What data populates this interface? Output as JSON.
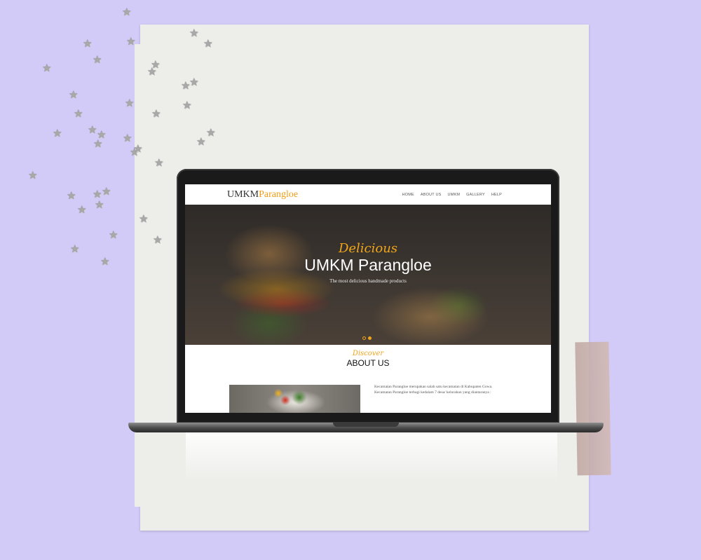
{
  "site": {
    "logo_part1": "UMKM",
    "logo_part2": "Parangloe",
    "menu": [
      "HOME",
      "ABOUT US",
      "UMKM",
      "GALLERY",
      "HELP"
    ]
  },
  "hero": {
    "script": "Delicious",
    "title": "UMKM Parangloe",
    "subtitle": "The most delicious handmade products"
  },
  "about": {
    "kicker": "Discover",
    "heading": "ABOUT US",
    "paragraph": "Kecamatan Parangloe merupakan salah satu kecamatan di Kabupaten Gowa. Kecamatan Parangloe terbagi kedalam 7 desa/ kelurahan yang diantaranya :"
  },
  "colors": {
    "background": "#d3cbf7",
    "accent": "#f39c12",
    "paper": "#ededea"
  }
}
